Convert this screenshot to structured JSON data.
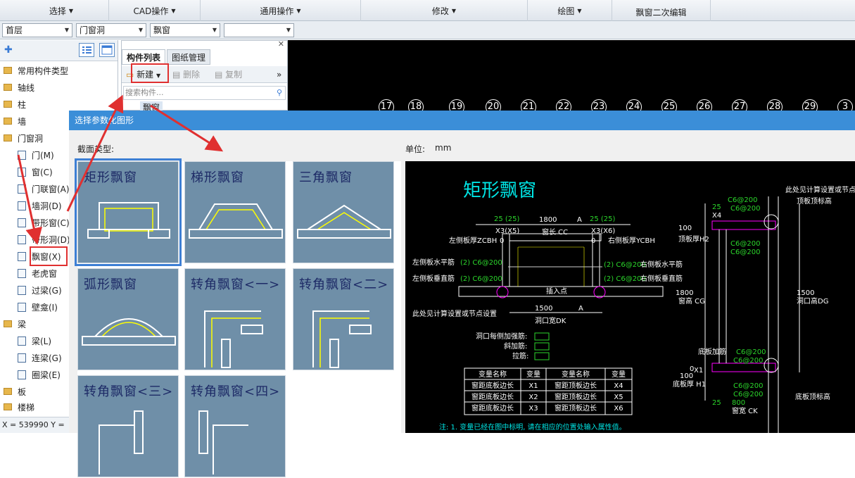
{
  "menubar": {
    "items": [
      {
        "label": "选择"
      },
      {
        "label": "CAD操作"
      },
      {
        "label": "通用操作"
      },
      {
        "label": "修改"
      },
      {
        "label": "绘图"
      },
      {
        "label": "飘窗二次编辑"
      }
    ]
  },
  "toolbar2": {
    "floor": "首层",
    "category": "门窗洞",
    "component": "飘窗",
    "empty": ""
  },
  "tree": {
    "nodes": [
      {
        "label": "常用构件类型",
        "type": "folder"
      },
      {
        "label": "轴线",
        "type": "folder"
      },
      {
        "label": "柱",
        "type": "folder"
      },
      {
        "label": "墙",
        "type": "folder"
      },
      {
        "label": "门窗洞",
        "type": "folder-open"
      },
      {
        "label": "门(M)",
        "type": "item"
      },
      {
        "label": "窗(C)",
        "type": "item"
      },
      {
        "label": "门联窗(A)",
        "type": "item"
      },
      {
        "label": "墙洞(D)",
        "type": "item"
      },
      {
        "label": "带形窗(C)",
        "type": "item"
      },
      {
        "label": "带形洞(D)",
        "type": "item"
      },
      {
        "label": "飘窗(X)",
        "type": "item"
      },
      {
        "label": "老虎窗",
        "type": "item"
      },
      {
        "label": "过梁(G)",
        "type": "item"
      },
      {
        "label": "壁龛(I)",
        "type": "item"
      },
      {
        "label": "梁",
        "type": "folder"
      },
      {
        "label": "梁(L)",
        "type": "item"
      },
      {
        "label": "连梁(G)",
        "type": "item"
      },
      {
        "label": "圈梁(E)",
        "type": "item"
      },
      {
        "label": "板",
        "type": "folder"
      },
      {
        "label": "楼梯",
        "type": "folder"
      }
    ]
  },
  "status": {
    "coords": "X = 539990 Y ="
  },
  "complist": {
    "tabs": [
      "构件列表",
      "图纸管理"
    ],
    "new_label": "新建",
    "delete_label": "删除",
    "copy_label": "复制",
    "search_placeholder": "搜索构件...",
    "item": "飘窗"
  },
  "cad": {
    "axes": [
      "17",
      "18",
      "19",
      "20",
      "21",
      "22",
      "23",
      "24",
      "25",
      "26",
      "27",
      "28",
      "29",
      "3"
    ]
  },
  "dialog": {
    "title": "选择参数化图形",
    "section_label": "截面类型:",
    "unit_label": "单位:",
    "unit": "mm",
    "shapes": [
      "矩形飘窗",
      "梯形飘窗",
      "三角飘窗",
      "弧形飘窗",
      "转角飘窗<一>",
      "转角飘窗<二>",
      "转角飘窗<三>",
      "转角飘窗<四>"
    ],
    "selected": "矩形飘窗"
  },
  "preview": {
    "title": "矩形飘窗",
    "labels": {
      "c25a": "25 (25)",
      "c1800": "1800",
      "ca": "A",
      "c25b": "25 (25)",
      "x3x5": "X3(X5)",
      "windowlen": "窗长 CC",
      "x3x6": "X3(X6)",
      "lzc": "左侧板厚ZCBH",
      "z0": "0",
      "z0b": "0",
      "rzc": "右侧板厚YCBH",
      "lhp": "左侧板水平筋",
      "lhpv": "(2) C6@200",
      "rhpv": "(2) C6@200",
      "rhp": "右侧板水平筋",
      "lvt": "左侧板垂直筋",
      "lvtv": "(2) C6@200",
      "rvtv": "(2) C6@200",
      "rvt": "右侧板垂直筋",
      "ins": "插入点",
      "c1500": "1500",
      "ca2": "A",
      "calc": "此处见计算设置或节点设置",
      "holew": "洞口宽DK",
      "reinf": "洞口每侧加强筋:",
      "xie": "斜加筋:",
      "la": "拉筋:",
      "note": "注: 1. 变量已经在图中标明, 请在相应的位置处输入属性值。",
      "r_calc": "此处见计算设置或节点",
      "r_top": "顶板顶标高",
      "r_c1": "C6@200",
      "r_c2": "C6@200",
      "r_25": "25",
      "r_x4": "X4",
      "r_100": "100",
      "r_h2": "顶板厚H2",
      "r_c3": "C6@200",
      "r_c4": "C6@200",
      "r_1800": "1800",
      "r_cg": "窗高 CG",
      "r_1500": "1500",
      "r_dg": "洞口高DG",
      "r_bot": "底板加筋",
      "r_c5": "C6@200",
      "r_c6": "C6@200",
      "r_100b": "100",
      "r_h1": "底板厚 H1",
      "r_c7": "C6@200",
      "r_c8": "C6@200",
      "r_botel": "底板顶标高",
      "r_25b": "25",
      "r_800": "800",
      "r_ck": "窗宽 CK",
      "r_x1": "X1",
      "r_0": "0"
    },
    "table": {
      "headers": [
        "变量名称",
        "变量",
        "变量名称",
        "变量"
      ],
      "rows": [
        [
          "窗距底板边长",
          "X1",
          "窗距顶板边长",
          "X4"
        ],
        [
          "窗距底板边长",
          "X2",
          "窗距顶板边长",
          "X5"
        ],
        [
          "窗距底板边长",
          "X3",
          "窗距顶板边长",
          "X6"
        ]
      ]
    }
  }
}
